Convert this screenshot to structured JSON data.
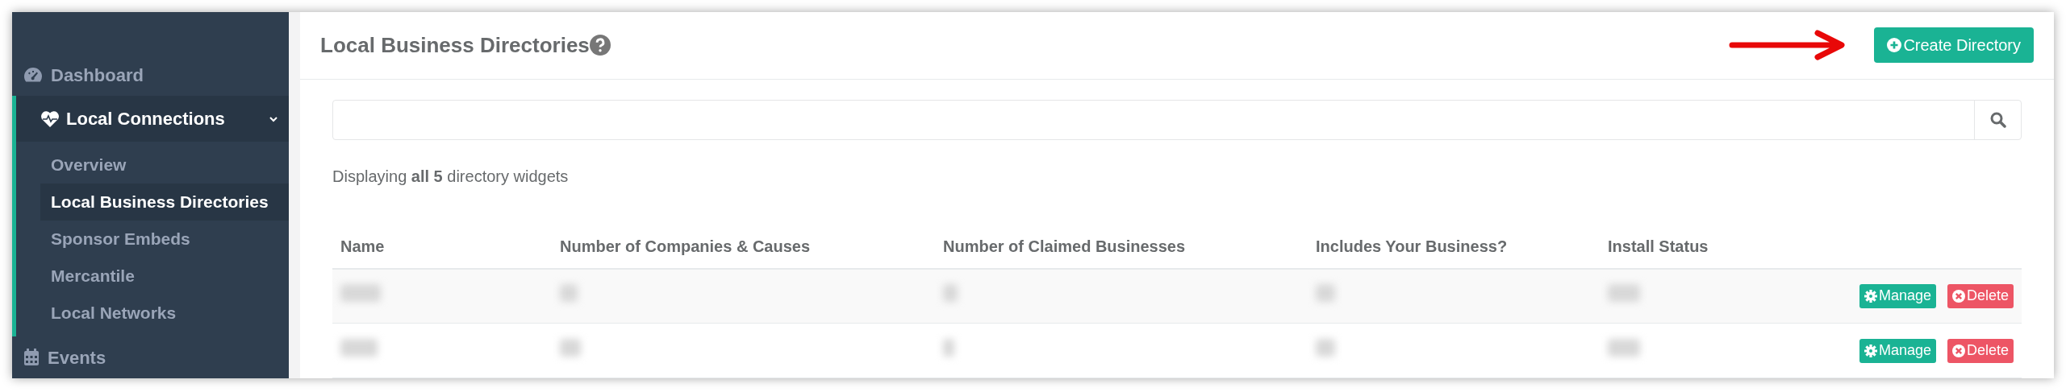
{
  "sidebar": {
    "items": [
      {
        "label": "Dashboard",
        "expanded": false
      },
      {
        "label": "Local Connections",
        "expanded": true,
        "children": [
          {
            "label": "Overview",
            "selected": false
          },
          {
            "label": "Local Business Directories",
            "selected": true
          },
          {
            "label": "Sponsor Embeds",
            "selected": false
          },
          {
            "label": "Mercantile",
            "selected": false
          },
          {
            "label": "Local Networks",
            "selected": false
          }
        ]
      },
      {
        "label": "Events",
        "expanded": false
      }
    ]
  },
  "header": {
    "title": "Local Business Directories",
    "create_button": "Create Directory"
  },
  "summary": "Displaying **all 5** directory widgets",
  "table": {
    "columns": [
      "Name",
      "Number of Companies & Causes",
      "Number of Claimed Businesses",
      "Includes Your Business?",
      "Install Status"
    ],
    "rows": [
      {
        "actions": [
          "Manage",
          "Delete"
        ]
      },
      {
        "actions": [
          "Manage",
          "Delete"
        ]
      }
    ]
  }
}
